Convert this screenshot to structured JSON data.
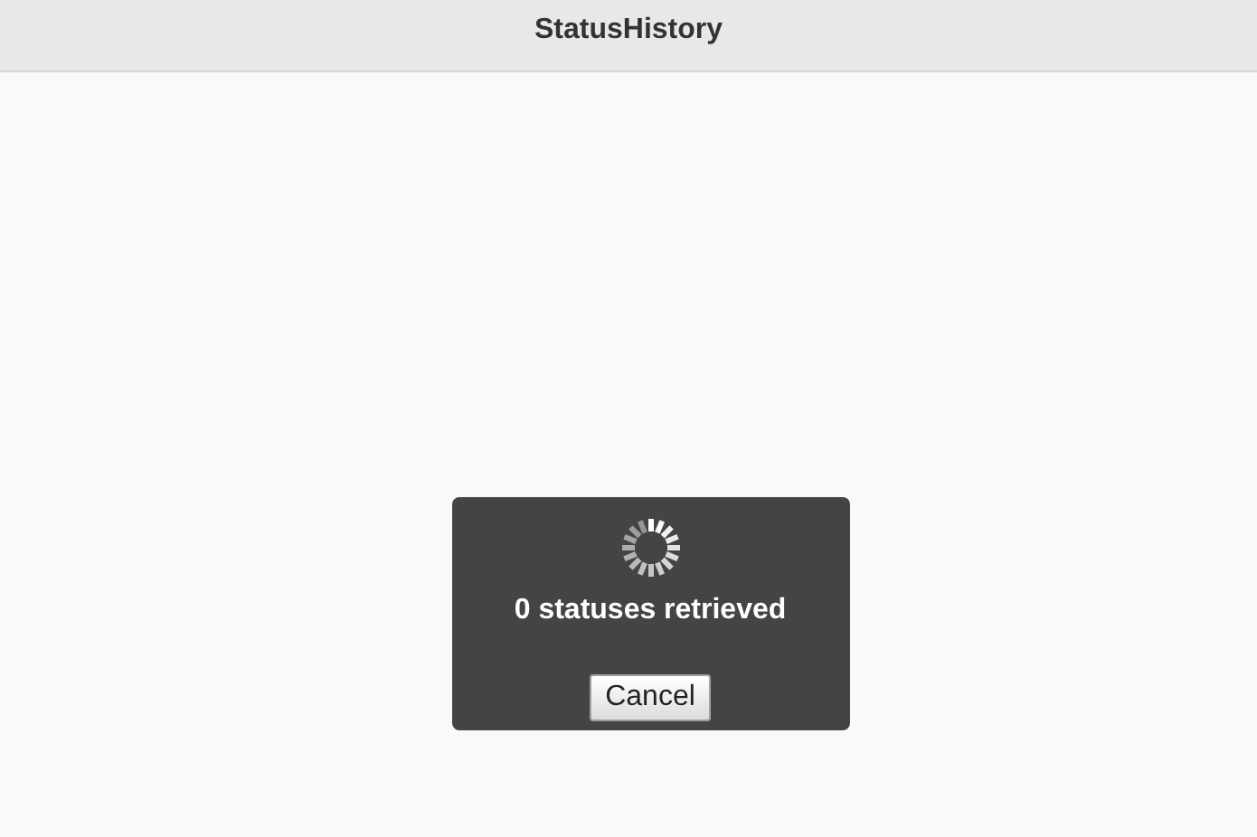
{
  "header": {
    "title": "StatusHistory"
  },
  "dialog": {
    "message": "0 statuses retrieved",
    "buttons": [
      "Cancel"
    ]
  }
}
